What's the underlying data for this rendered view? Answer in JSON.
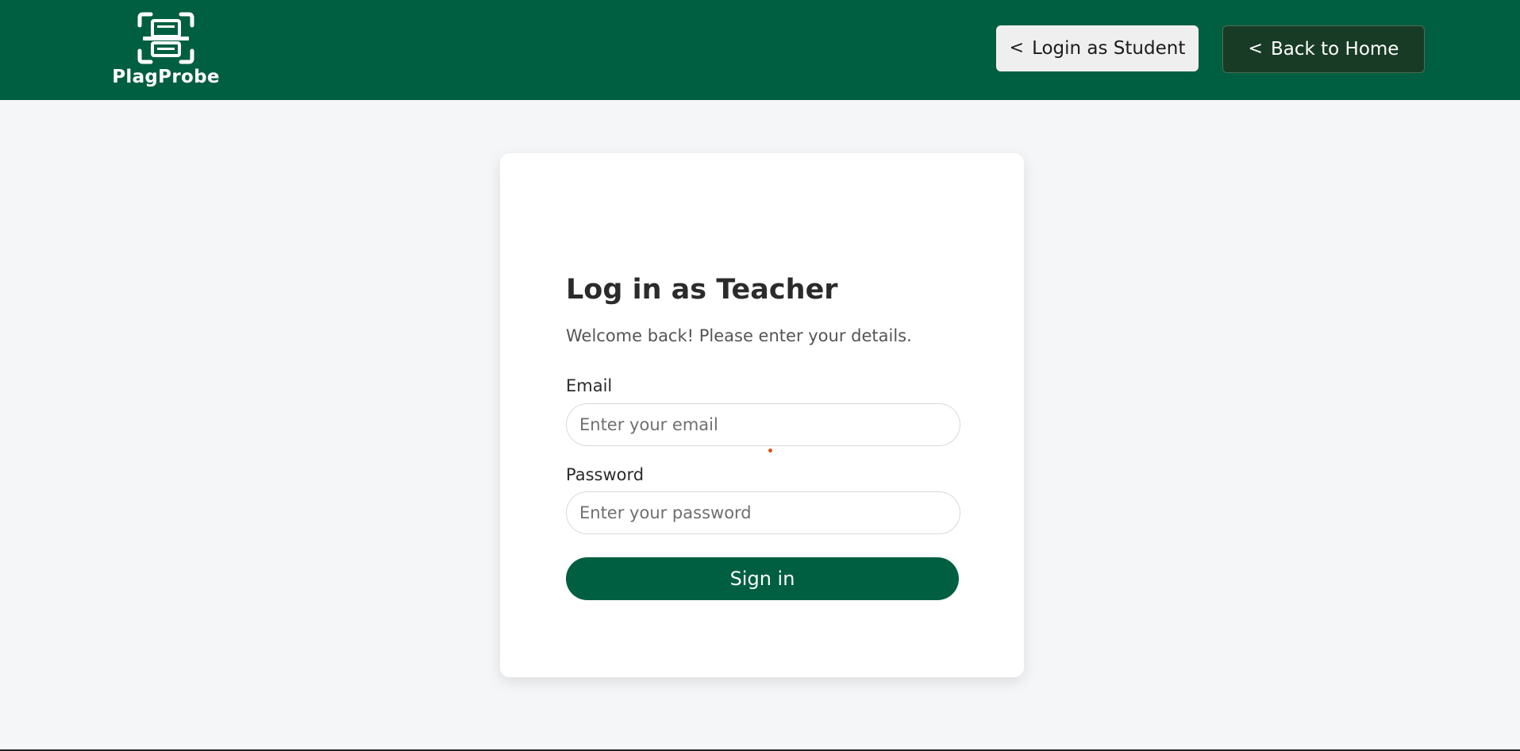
{
  "header": {
    "brand_name": "PlagProbe",
    "brand_icon": "document-scan-icon",
    "login_student_label": "Login as Student",
    "back_home_label": "Back to Home",
    "chevron": "<",
    "background_color": "#005f40"
  },
  "login_form": {
    "title": "Log in as Teacher",
    "subtitle": "Welcome back! Please enter your details.",
    "email_label": "Email",
    "email_placeholder": "Enter your email",
    "password_label": "Password",
    "password_placeholder": "Enter your password",
    "submit_label": "Sign in",
    "accent_color": "#005f40"
  }
}
